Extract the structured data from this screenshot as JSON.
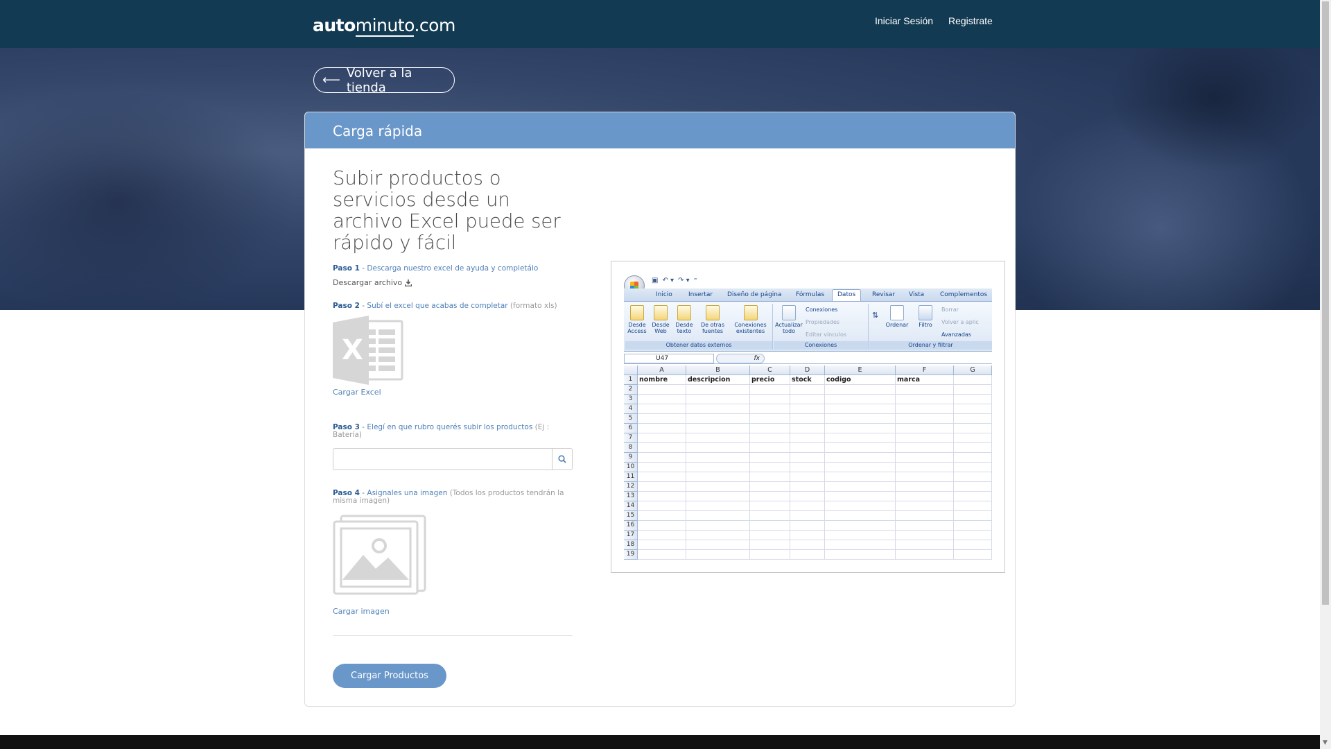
{
  "header": {
    "logo_bold": "auto",
    "logo_light": "minuto",
    "logo_tld": ".com",
    "login": "Iniciar Sesión",
    "register": "Registrate"
  },
  "back_button": {
    "icon": "arrow-left-icon",
    "label": "Volver a la tienda"
  },
  "card": {
    "title": "Carga rápida",
    "headline": "Subir productos o servicios desde un archivo Excel puede ser rápido y fácil",
    "step1": {
      "label": "Paso 1",
      "text": " - Descarga nuestro excel de ayuda y completálo",
      "download_link": "Descargar archivo"
    },
    "step2": {
      "label": "Paso 2",
      "text": " - Subí el excel que acabas de completar ",
      "note": "(formato xls)",
      "upload_link": "Cargar Excel"
    },
    "step3": {
      "label": "Paso 3",
      "text": " - Elegí en que rubro querés subir los productos ",
      "note": "(Ej : Batería)",
      "search_placeholder": ""
    },
    "step4": {
      "label": "Paso 4",
      "text": " - Asignales una imagen ",
      "note": "(Todos los productos tendrán la misma imagen)",
      "upload_link": "Cargar imagen"
    },
    "submit": "Cargar Productos"
  },
  "excel": {
    "tabs": [
      "Inicio",
      "Insertar",
      "Diseño de página",
      "Fórmulas",
      "Datos",
      "Revisar",
      "Vista",
      "Complementos"
    ],
    "active_tab": "Datos",
    "ribbon": {
      "buttons": [
        "Desde Access",
        "Desde Web",
        "Desde texto",
        "De otras fuentes",
        "Conexiones existentes",
        "Actualizar todo",
        "Ordenar",
        "Filtro"
      ],
      "small": [
        "Conexiones",
        "Propiedades",
        "Editar vínculos",
        "Borrar",
        "Volver a aplic",
        "Avanzadas"
      ],
      "groups": [
        "Obtener datos externos",
        "Conexiones",
        "Ordenar y filtrar"
      ]
    },
    "name_box": "U47",
    "fx": "fx",
    "columns": [
      "A",
      "B",
      "C",
      "D",
      "E",
      "F",
      "G"
    ],
    "row1": [
      "nombre",
      "descripcion",
      "precio",
      "stock",
      "codigo",
      "marca",
      ""
    ],
    "row_numbers": [
      "1",
      "2",
      "3",
      "4",
      "5",
      "6",
      "7",
      "8",
      "9",
      "10",
      "11",
      "12",
      "13",
      "14",
      "15",
      "16",
      "17",
      "18",
      "19"
    ]
  },
  "colors": {
    "topbar": "#123a52",
    "card_header": "#6a97ca",
    "link": "#4e7fb8"
  }
}
